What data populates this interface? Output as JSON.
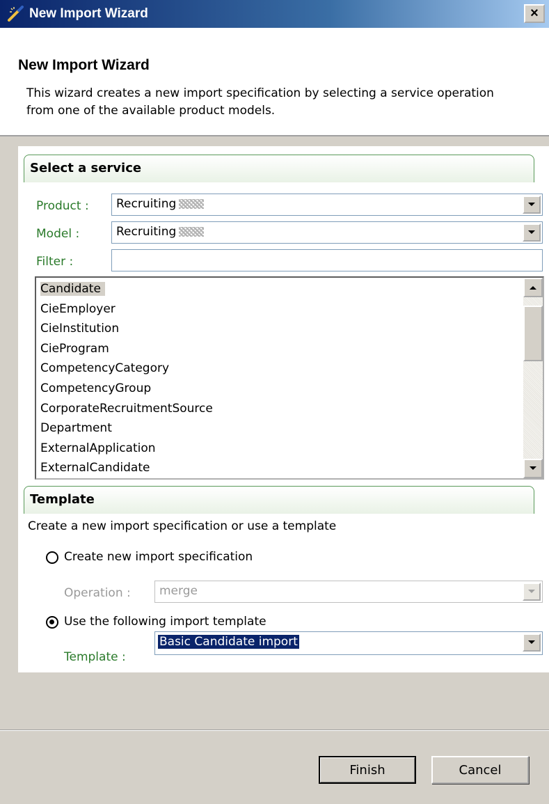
{
  "window": {
    "title": "New Import Wizard",
    "close_label": "×"
  },
  "header": {
    "title": "New Import Wizard",
    "description": "This wizard creates a new import specification by selecting a service operation from one of the available product models."
  },
  "select_service": {
    "section_title": "Select a service",
    "product": {
      "label": "Product :",
      "value": "Recruiting"
    },
    "model": {
      "label": "Model    :",
      "value": "Recruiting"
    },
    "filter": {
      "label": "Filter     :",
      "value": ""
    },
    "list_items": [
      "Candidate",
      "CieEmployer",
      "CieInstitution",
      "CieProgram",
      "CompetencyCategory",
      "CompetencyGroup",
      "CorporateRecruitmentSource",
      "Department",
      "ExternalApplication",
      "ExternalCandidate"
    ],
    "selected_item": "Candidate"
  },
  "template": {
    "section_title": "Template",
    "instruction": "Create a new import specification or use a template",
    "create_new": {
      "label": "Create new import specification",
      "checked": false,
      "operation_label": "Operation :",
      "operation_value": "merge"
    },
    "use_template": {
      "label": "Use the following import template",
      "checked": true,
      "template_label": "Template  :",
      "template_value": "Basic Candidate import"
    }
  },
  "buttons": {
    "finish": "Finish",
    "cancel": "Cancel"
  },
  "colors": {
    "title_bar": "#0a246a",
    "field_label_green": "#2a7a2a",
    "section_border": "#5a9a5a",
    "dialog_bg": "#d4d0c8"
  }
}
